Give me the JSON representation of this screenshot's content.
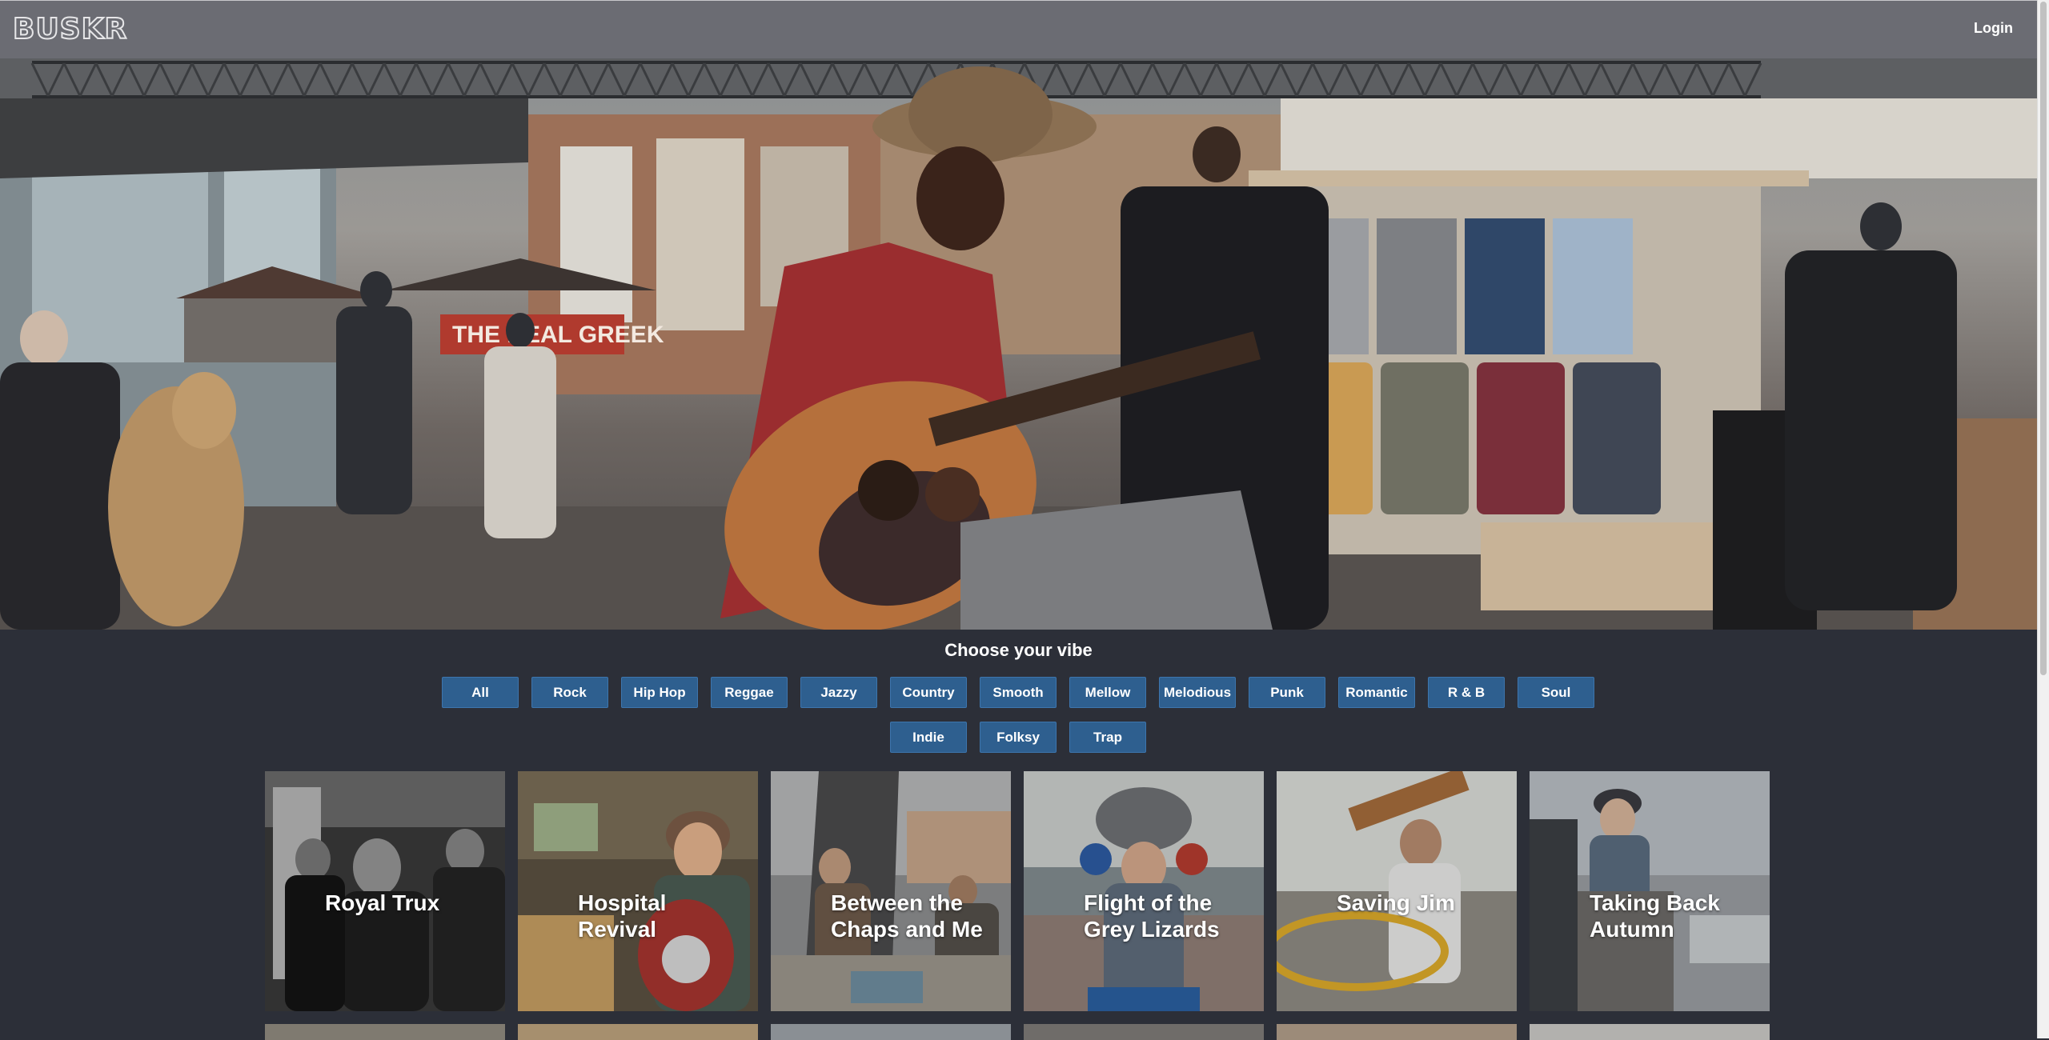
{
  "app": {
    "logo_text": "BUSKR",
    "login_label": "Login"
  },
  "hero": {
    "sign_text": "THE REAL GREEK"
  },
  "vibe": {
    "title": "Choose your vibe",
    "genres_row1": [
      "All",
      "Rock",
      "Hip Hop",
      "Reggae",
      "Jazzy",
      "Country",
      "Smooth",
      "Mellow",
      "Melodious",
      "Punk",
      "Romantic",
      "R & B",
      "Soul"
    ],
    "genres_row2": [
      "Indie",
      "Folksy",
      "Trap"
    ]
  },
  "artists": [
    {
      "name": "Royal Trux"
    },
    {
      "name": "Hospital Revival"
    },
    {
      "name": "Between the Chaps and Me"
    },
    {
      "name": "Flight of the Grey Lizards"
    },
    {
      "name": "Saving Jim"
    },
    {
      "name": "Taking Back Autumn"
    }
  ],
  "colors": {
    "topbar": "#6b6c73",
    "page_bg": "#2c2f38",
    "chip_bg": "#2e5f8f"
  }
}
